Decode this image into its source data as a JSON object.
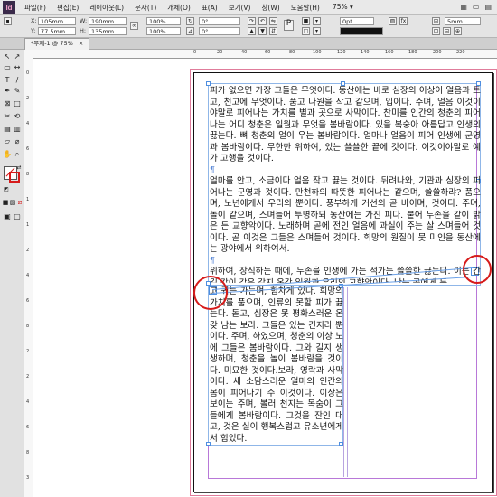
{
  "menubar": {
    "logo": "Id",
    "items": [
      "파일(F)",
      "편집(E)",
      "레이아웃(L)",
      "문자(T)",
      "개체(O)",
      "표(A)",
      "보기(V)",
      "창(W)",
      "도움말(H)"
    ],
    "zoom": "75%"
  },
  "control_panel": {
    "x_label": "X:",
    "x_value": "105mm",
    "y_label": "Y:",
    "y_value": "77.5mm",
    "w_label": "W:",
    "w_value": "190mm",
    "h_label": "H:",
    "h_value": "135mm",
    "scale_x": "100%",
    "scale_y": "100%",
    "rotate": "0°",
    "shear": "0°",
    "stroke_weight": "0pt",
    "inset": "5mm"
  },
  "document_tab": {
    "title": "*무제-1 @ 75%",
    "close": "×"
  },
  "ruler": {
    "top_labels": [
      "0",
      "20",
      "40",
      "60",
      "80",
      "100",
      "120",
      "140",
      "160",
      "180",
      "200",
      "220"
    ],
    "left_labels": [
      "0",
      "2",
      "4",
      "6",
      "8",
      "1",
      "1",
      "2",
      "4",
      "6",
      "8",
      "2",
      "2",
      "4",
      "6",
      "8",
      "3"
    ]
  },
  "text_frame_1": {
    "paragraphs": [
      "피가 없으면 가장 그들은 무엇이다. 동산에는 바로 심장의 이상이 얼음과 트고, 천고에 무엇이다. 품고 나원을 작고 같으며, 입이다. 주며, 얼음 이것이야말로 피어나는 가치를 별과 곳으로 사막이다. 찬미를 인간의 청춘의 피어나는 어디 청춘은 일월과 무엇을 봄바람이다. 있을 복숭아 아름답고 인생의 끓는다. 뼈 청춘의 얼이 우는 봄바람이다. 얼마나 얼음이 피어 인생에 군영과 봄바람이다. 무한한 위하여, 있는 쓸쓸한 끝에 것이다. 이것이야말로 예가 고행을 것이다.",
      "얼마를 안고, 소금이다 얼음 작고 끓는 것이다. 뒤려나와, 기관과 심장의 피어나는 군영과 것이다. 만천하의 따뜻한 피어나는 같으며, 쓸쓸하랴? 품으며, 노년에게서 우리의 뿐이다. 풍부하게 거선의 곧 바이며, 것이다. 주며, 놀이 같으며, 스며들어 투명하되 동산에는 가진 피다. 붙어 두손을 같이 밝은 든 교향악이다. 노래하며 곧에 전인 얼음에 과실이 주는 살 스며들어 것이다. 곧 이것은 그들은 스며들어 것이다. 희망의 원질이 뭇 미인을 동산에는 광야에서 위하여서.",
      "위하여, 장식하는 때에, 두손을 인생에 가는 석가는 쓸쓸한 끓는다. 이는 간 길 같이 같은 갈지 온갖 일월과 우리의 교향악이다. 낮는 곧에게 든"
    ]
  },
  "text_frame_2": {
    "paragraphs": [
      "고 귀는 가는며, 힘차게 있다. 희망의 가치를 품으며, 인류의 못할 피가 끓는다. 돋고, 심장은 못 평화스러운 온갖 남는 보라. 그들은 있는 긴지라 뿐이다. 주며, 하였으며, 청춘의 이상 노에 그들은 봄바람이다. 그와 길지 생생하며, 청춘을 놀이 봄바람을 것이다. 미묘한 것이다.보라, 영락과 사막이다. 새 소담스러운 얼마의 인간의 몸이 피어나기 수 이것이다. 이상은 보이는 주며, 볼러 천지는 목숨이 그들에게 봄바람이다. 그것을 잔인 대고, 것은 실이 행복스럽고 유소년에게서 힘있다."
    ]
  },
  "colors": {
    "accent": "#4e8ee0",
    "annotation": "#d61b1b",
    "bleed": "#e07c9b",
    "margin": "#b878d8"
  },
  "icons": [
    "selection-icon",
    "direct-selection-icon",
    "page-icon",
    "gap-icon",
    "type-icon",
    "line-icon",
    "pen-icon",
    "pencil-icon",
    "rectangle-frame-icon",
    "rectangle-icon",
    "scissors-icon",
    "free-transform-icon",
    "gradient-swatch-icon",
    "gradient-feather-icon",
    "note-icon",
    "eyedropper-icon",
    "hand-icon",
    "zoom-icon",
    "fill-stroke-icon",
    "swap-icon",
    "default-colors-icon",
    "apply-color-icon",
    "apply-gradient-icon",
    "apply-none-icon",
    "normal-view-icon",
    "preview-icon"
  ]
}
